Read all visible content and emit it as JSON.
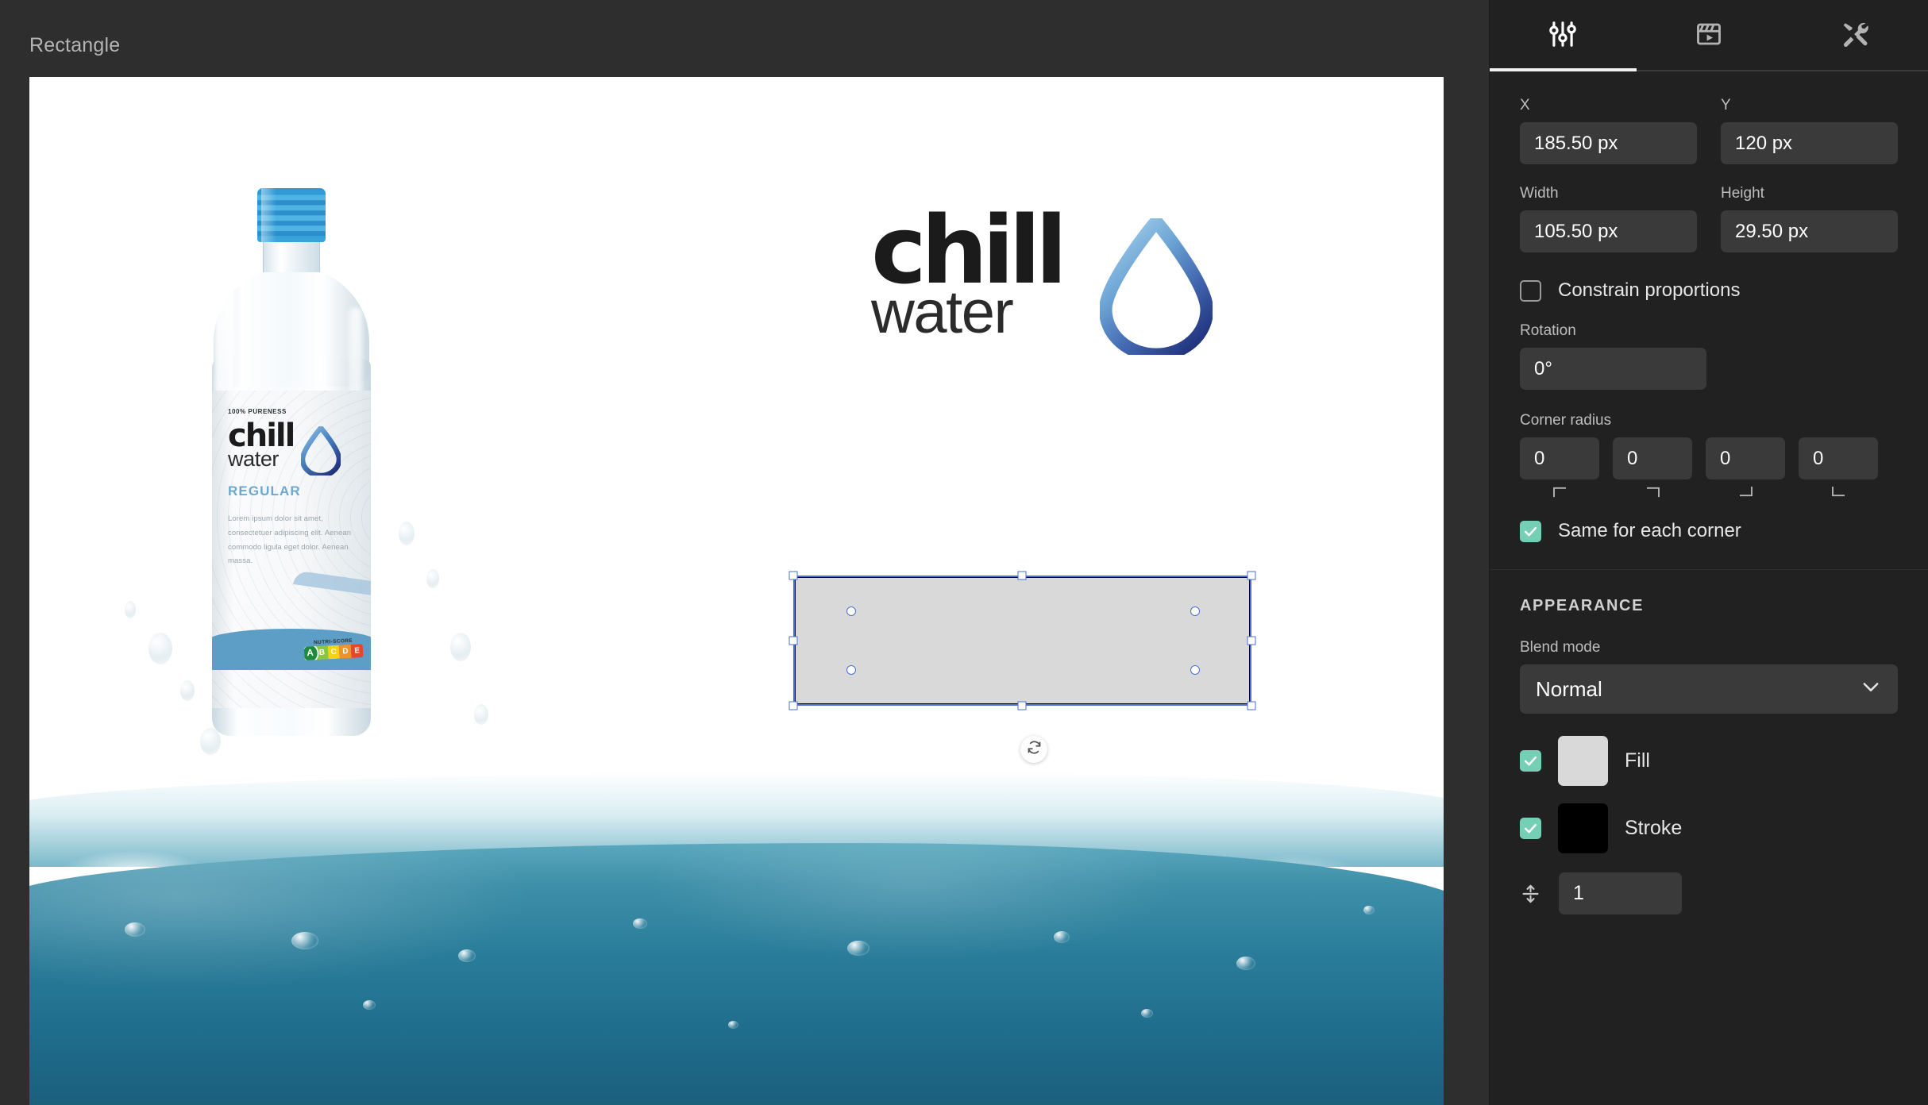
{
  "document": {
    "title": "Rectangle"
  },
  "tabs": [
    {
      "name": "properties",
      "icon": "sliders-icon",
      "active": true
    },
    {
      "name": "animation",
      "icon": "clapperboard-icon",
      "active": false
    },
    {
      "name": "tools",
      "icon": "tools-icon",
      "active": false
    }
  ],
  "transform": {
    "x_label": "X",
    "x_value": "185.50 px",
    "y_label": "Y",
    "y_value": "120 px",
    "width_label": "Width",
    "width_value": "105.50 px",
    "height_label": "Height",
    "height_value": "29.50 px",
    "constrain_label": "Constrain proportions",
    "constrain_checked": false,
    "rotation_label": "Rotation",
    "rotation_value": "0°",
    "corner_radius_label": "Corner radius",
    "corner_radius_values": [
      "0",
      "0",
      "0",
      "0"
    ],
    "corner_marks": [
      "top-left-corner-icon",
      "top-right-corner-icon",
      "bottom-right-corner-icon",
      "bottom-left-corner-icon"
    ],
    "same_corner_label": "Same for each corner",
    "same_corner_checked": true
  },
  "appearance": {
    "title": "APPEARANCE",
    "blend_mode_label": "Blend mode",
    "blend_mode_value": "Normal",
    "fill_label": "Fill",
    "fill_checked": true,
    "fill_color": "#d9d9d9",
    "stroke_label": "Stroke",
    "stroke_checked": true,
    "stroke_color": "#000000",
    "stroke_width_value": "1"
  },
  "colors": {
    "panel_bg": "#212121",
    "editor_bg": "#2e2e2e",
    "input_bg": "#3a3a3a",
    "accent": "#74cfb4",
    "selection": "#4a6fd8",
    "tab_active": "#f2f2f2"
  },
  "canvas": {
    "brand": {
      "chill": "chill",
      "water": "water"
    },
    "bottle_label": {
      "pureness": "100% PURENESS",
      "chill": "chill",
      "water": "water",
      "variant": "REGULAR",
      "description": "Lorem ipsum dolor sit amet, consectetuer adipiscing elit. Aenean commodo ligula eget dolor. Aenean massa.",
      "nutri_title": "NUTRI-SCORE",
      "nutri_grades": [
        "A",
        "B",
        "C",
        "D",
        "E"
      ],
      "nutri_selected": "A"
    },
    "selection": {
      "rotate_icon": "rotate-icon"
    }
  }
}
